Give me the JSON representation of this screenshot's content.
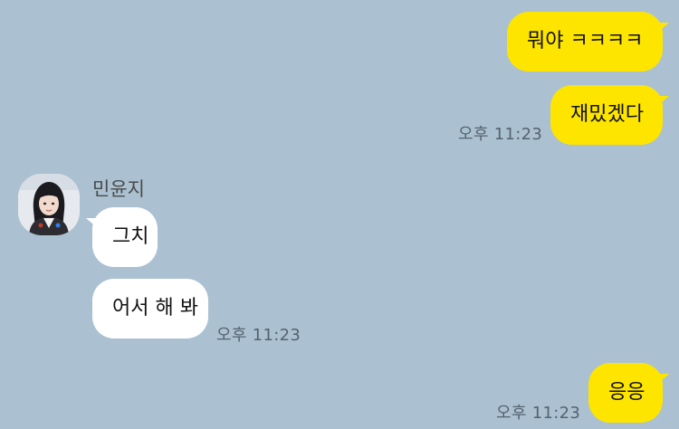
{
  "colors": {
    "background": "#abc1d1",
    "my_bubble": "#fee500",
    "their_bubble": "#ffffff",
    "time_text": "#556270"
  },
  "contact": {
    "name": "민윤지",
    "avatar_icon": "profile-photo-icon"
  },
  "messages": [
    {
      "sender": "me",
      "text": "뭐야 ㅋㅋㅋㅋ"
    },
    {
      "sender": "me",
      "text": "재밌겠다",
      "time": "오후 11:23"
    },
    {
      "sender": "them",
      "text": "그치"
    },
    {
      "sender": "them",
      "text": "어서 해 봐",
      "time": "오후 11:23"
    },
    {
      "sender": "me",
      "text": "응응",
      "time": "오후 11:23"
    }
  ]
}
